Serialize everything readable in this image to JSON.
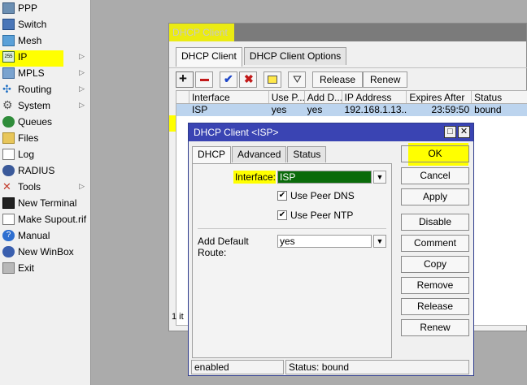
{
  "sidebar": {
    "items": [
      {
        "label": "PPP",
        "icon": "ppp-icon"
      },
      {
        "label": "Switch",
        "icon": "switch-icon"
      },
      {
        "label": "Mesh",
        "icon": "mesh-icon"
      },
      {
        "label": "IP",
        "icon": "ip-icon",
        "submenu": true
      },
      {
        "label": "MPLS",
        "icon": "mpls-icon",
        "submenu": true
      },
      {
        "label": "Routing",
        "icon": "routing-icon",
        "submenu": true
      },
      {
        "label": "System",
        "icon": "system-icon",
        "submenu": true
      },
      {
        "label": "Queues",
        "icon": "queues-icon"
      },
      {
        "label": "Files",
        "icon": "files-icon"
      },
      {
        "label": "Log",
        "icon": "log-icon"
      },
      {
        "label": "RADIUS",
        "icon": "radius-icon"
      },
      {
        "label": "Tools",
        "icon": "tools-icon",
        "submenu": true
      },
      {
        "label": "New Terminal",
        "icon": "terminal-icon"
      },
      {
        "label": "Make Supout.rif",
        "icon": "supout-icon"
      },
      {
        "label": "Manual",
        "icon": "manual-icon"
      },
      {
        "label": "New WinBox",
        "icon": "winbox-icon"
      },
      {
        "label": "Exit",
        "icon": "exit-icon"
      }
    ]
  },
  "window": {
    "title": "DHCP Client",
    "tabs": [
      "DHCP Client",
      "DHCP Client Options"
    ],
    "toolbar": {
      "release": "Release",
      "renew": "Renew"
    },
    "columns": [
      "Interface",
      "Use P...",
      "Add D...",
      "IP Address",
      "Expires After",
      "Status"
    ],
    "rows": [
      {
        "interface": "ISP",
        "use_peer": "yes",
        "add_default": "yes",
        "ip": "192.168.1.13...",
        "expires": "23:59:50",
        "status": "bound"
      }
    ],
    "count": "1 it"
  },
  "dialog": {
    "title": "DHCP Client <ISP>",
    "tabs": [
      "DHCP",
      "Advanced",
      "Status"
    ],
    "interface_label": "Interface:",
    "interface_value": "ISP",
    "use_peer_dns": "Use Peer DNS",
    "use_peer_ntp": "Use Peer NTP",
    "add_default_route_label": "Add Default Route:",
    "add_default_route_value": "yes",
    "buttons": [
      "OK",
      "Cancel",
      "Apply",
      "Disable",
      "Comment",
      "Copy",
      "Remove",
      "Release",
      "Renew"
    ],
    "status_left": "enabled",
    "status_right": "Status: bound"
  },
  "colors": {
    "highlight": "#ffff00",
    "dialog_title": "#3a44b3",
    "selected_row": "#bcd4ee",
    "interface_field": "#0a6b0a"
  }
}
